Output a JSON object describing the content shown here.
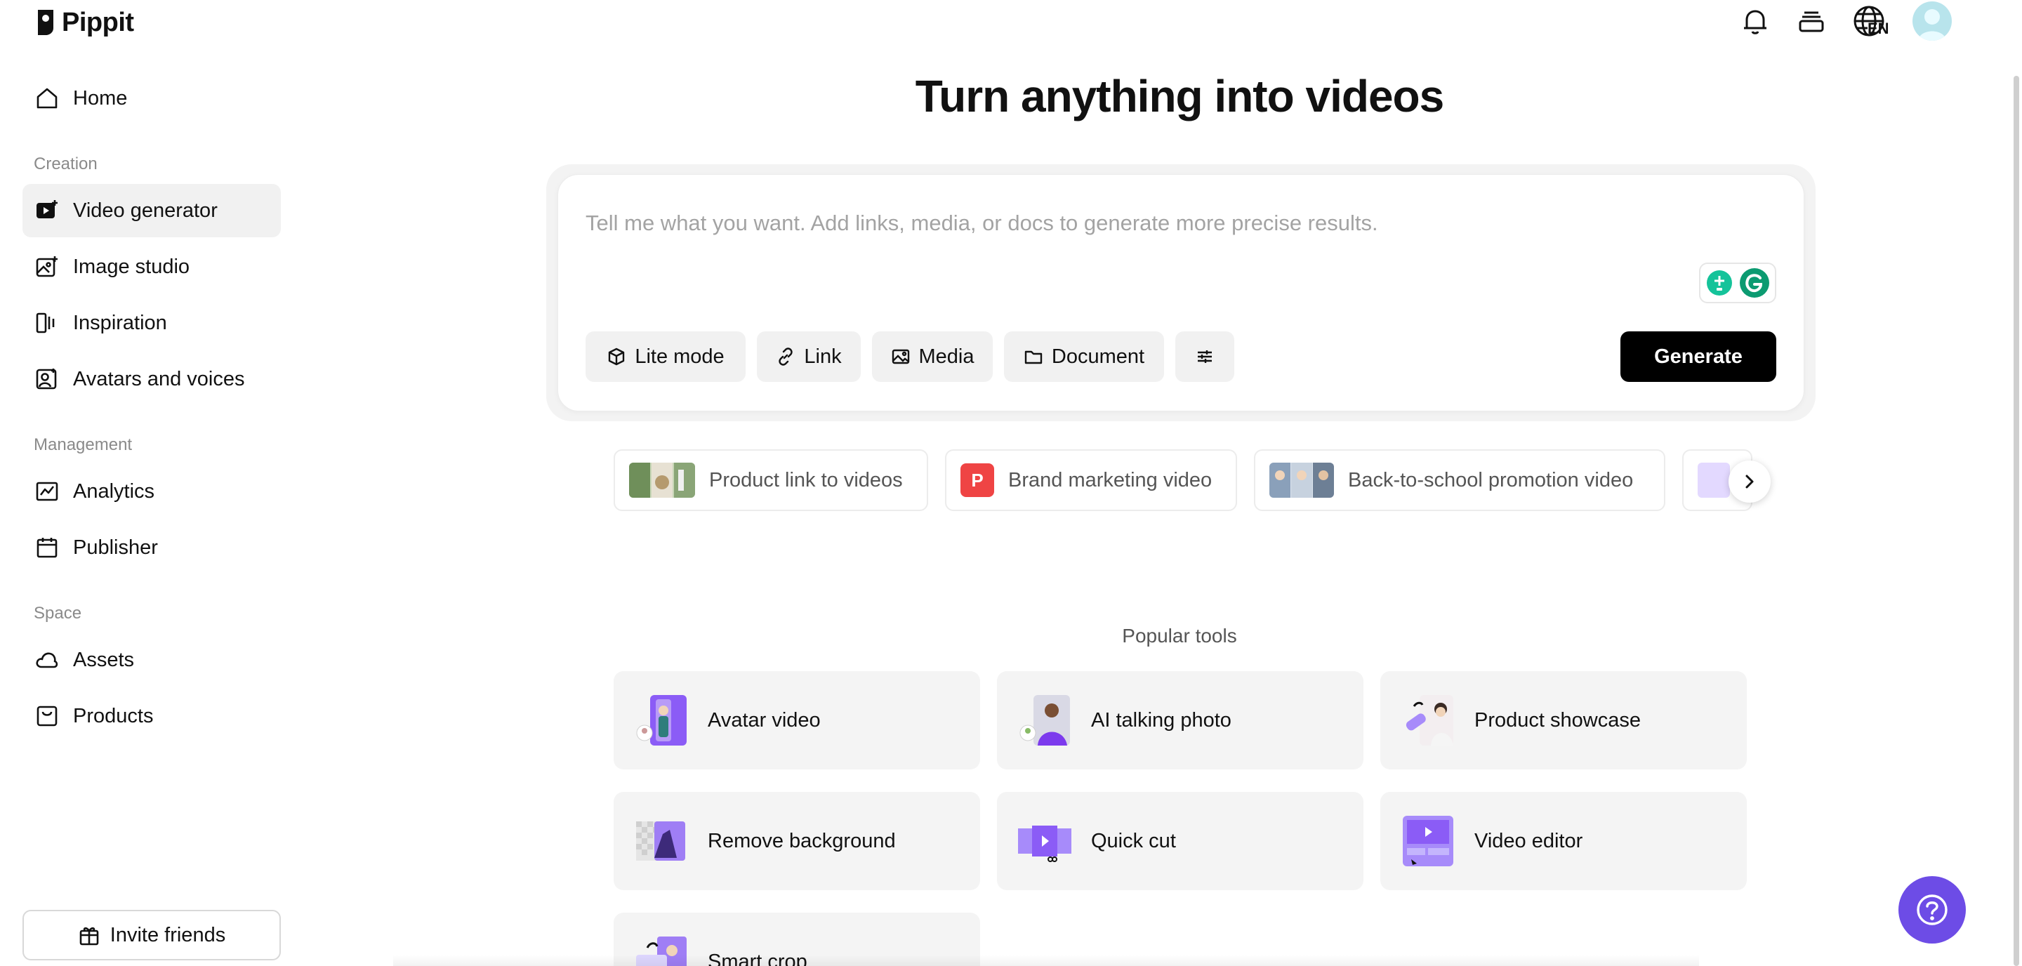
{
  "app": {
    "name": "Pippit"
  },
  "colors": {
    "accent": "#6d4ce6",
    "primary_button": "#000000",
    "active_nav": "#f1f1f1",
    "template_badge": "#ef4444"
  },
  "header": {
    "language": "EN"
  },
  "sidebar": {
    "home": "Home",
    "sections": {
      "creation": "Creation",
      "management": "Management",
      "space": "Space"
    },
    "creation_items": [
      "Video generator",
      "Image studio",
      "Inspiration",
      "Avatars and voices"
    ],
    "management_items": [
      "Analytics",
      "Publisher"
    ],
    "space_items": [
      "Assets",
      "Products"
    ],
    "invite": "Invite friends"
  },
  "main": {
    "title": "Turn anything into videos",
    "prompt": {
      "placeholder": "Tell me what you want. Add links, media, or docs to generate more precise results."
    },
    "chips": [
      "Lite mode",
      "Link",
      "Media",
      "Document"
    ],
    "generate": "Generate",
    "templates": [
      {
        "label": "Product link to videos"
      },
      {
        "label": "Brand marketing video",
        "badge": "P"
      },
      {
        "label": "Back-to-school promotion video"
      }
    ],
    "popular_label": "Popular tools",
    "tools": [
      "Avatar video",
      "AI talking photo",
      "Product showcase",
      "Remove background",
      "Quick cut",
      "Video editor",
      "Smart crop"
    ]
  }
}
